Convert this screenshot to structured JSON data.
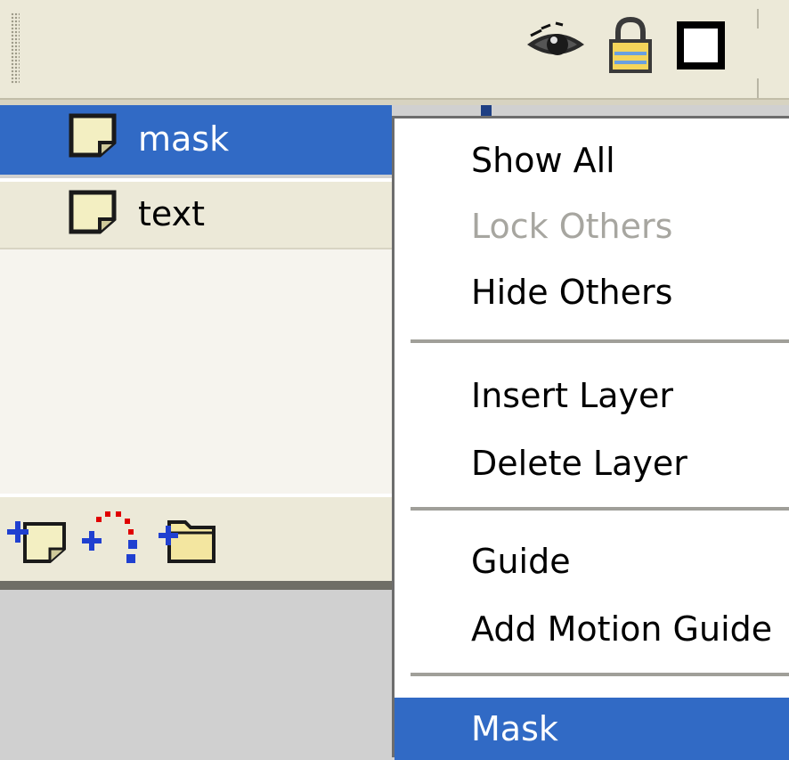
{
  "header": {
    "columns": [
      "eye-icon",
      "lock-icon",
      "outline-icon"
    ]
  },
  "layers": [
    {
      "name": "mask",
      "selected": true,
      "icon": "layer-icon"
    },
    {
      "name": "text",
      "selected": false,
      "icon": "layer-icon"
    }
  ],
  "toolbar": {
    "buttons": [
      "insert-layer-icon",
      "add-motion-guide-icon",
      "insert-layer-folder-icon"
    ]
  },
  "context_menu": {
    "items": [
      {
        "label": "Show All",
        "state": "enabled"
      },
      {
        "label": "Lock Others",
        "state": "disabled"
      },
      {
        "label": "Hide Others",
        "state": "enabled"
      },
      {
        "label": "Insert Layer",
        "state": "enabled"
      },
      {
        "label": "Delete Layer",
        "state": "enabled"
      },
      {
        "label": "Guide",
        "state": "enabled"
      },
      {
        "label": "Add Motion Guide",
        "state": "enabled"
      },
      {
        "label": "Mask",
        "state": "selected"
      }
    ]
  },
  "colors": {
    "selection": "#316ac5",
    "panel": "#ece9d8",
    "disabled_text": "#a7a6a0"
  }
}
